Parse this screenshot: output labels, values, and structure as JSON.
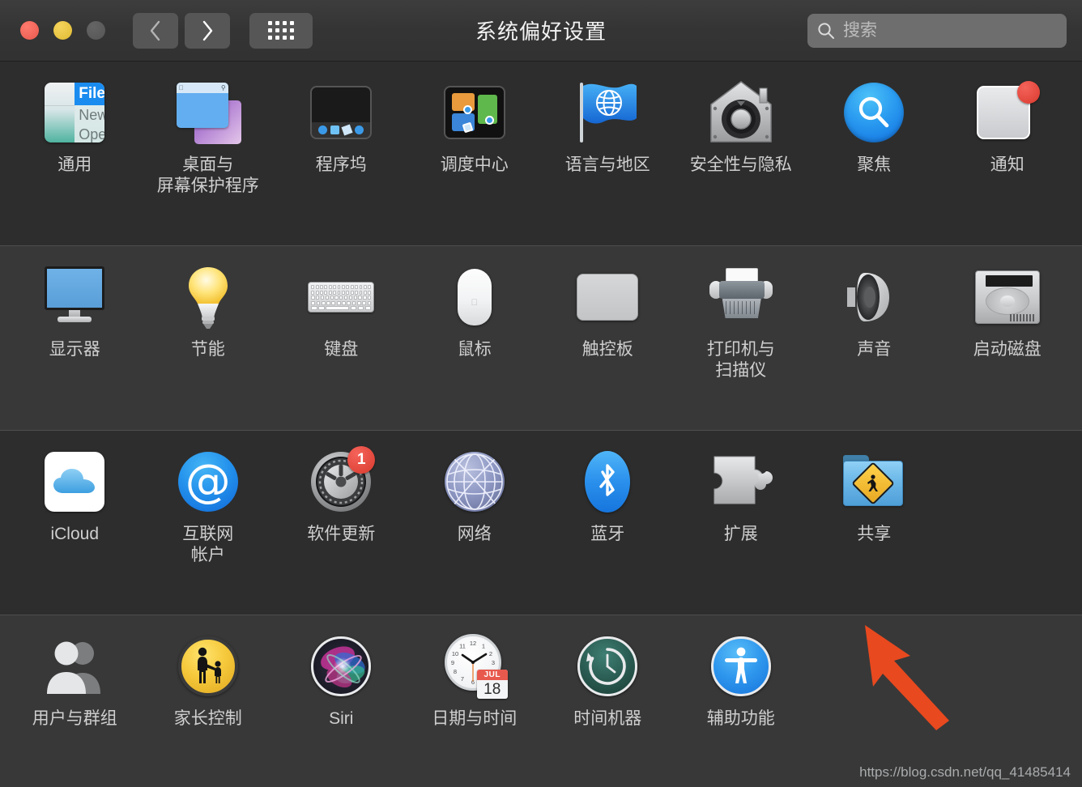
{
  "window": {
    "title": "系统偏好设置",
    "traffic_lights": [
      "close",
      "minimize",
      "zoom"
    ],
    "nav": {
      "back": "‹",
      "forward": "›",
      "grid": "grid-view"
    }
  },
  "search": {
    "placeholder": "搜索",
    "value": "",
    "icon": "search-icon"
  },
  "rows": [
    {
      "items": [
        {
          "label": "通用",
          "icon": "general-icon",
          "menu_file": "File",
          "menu_new": "New",
          "menu_open": "Ope"
        },
        {
          "label": "桌面与\n屏幕保护程序",
          "icon": "desktop-screensaver-icon"
        },
        {
          "label": "程序坞",
          "icon": "dock-icon"
        },
        {
          "label": "调度中心",
          "icon": "mission-control-icon"
        },
        {
          "label": "语言与地区",
          "icon": "language-region-icon"
        },
        {
          "label": "安全性与隐私",
          "icon": "security-privacy-icon"
        },
        {
          "label": "聚焦",
          "icon": "spotlight-icon"
        },
        {
          "label": "通知",
          "icon": "notifications-icon"
        }
      ]
    },
    {
      "items": [
        {
          "label": "显示器",
          "icon": "displays-icon"
        },
        {
          "label": "节能",
          "icon": "energy-saver-icon"
        },
        {
          "label": "键盘",
          "icon": "keyboard-icon"
        },
        {
          "label": "鼠标",
          "icon": "mouse-icon"
        },
        {
          "label": "触控板",
          "icon": "trackpad-icon"
        },
        {
          "label": "打印机与\n扫描仪",
          "icon": "printers-scanners-icon"
        },
        {
          "label": "声音",
          "icon": "sound-icon"
        },
        {
          "label": "启动磁盘",
          "icon": "startup-disk-icon"
        }
      ]
    },
    {
      "items": [
        {
          "label": "iCloud",
          "icon": "icloud-icon"
        },
        {
          "label": "互联网\n帐户",
          "icon": "internet-accounts-icon"
        },
        {
          "label": "软件更新",
          "icon": "software-update-icon",
          "badge": "1"
        },
        {
          "label": "网络",
          "icon": "network-icon"
        },
        {
          "label": "蓝牙",
          "icon": "bluetooth-icon"
        },
        {
          "label": "扩展",
          "icon": "extensions-icon"
        },
        {
          "label": "共享",
          "icon": "sharing-icon"
        },
        {
          "label": "",
          "icon": ""
        }
      ]
    },
    {
      "items": [
        {
          "label": "用户与群组",
          "icon": "users-groups-icon"
        },
        {
          "label": "家长控制",
          "icon": "parental-controls-icon"
        },
        {
          "label": "Siri",
          "icon": "siri-icon"
        },
        {
          "label": "日期与时间",
          "icon": "date-time-icon",
          "cal_month": "JUL",
          "cal_day": "18"
        },
        {
          "label": "时间机器",
          "icon": "time-machine-icon"
        },
        {
          "label": "辅助功能",
          "icon": "accessibility-icon"
        },
        {
          "label": "",
          "icon": ""
        },
        {
          "label": "",
          "icon": ""
        }
      ]
    }
  ],
  "annotation": {
    "arrow_color": "#e8491f",
    "points_to": "共享"
  },
  "watermark": "https://blog.csdn.net/qq_41485414",
  "colors": {
    "window_bg": "#2b2b2b",
    "row_dark": "#2d2d2d",
    "row_light": "#383838",
    "titlebar": "#343434",
    "label": "#cfcfcf",
    "badge_red": "#d93a2e",
    "accent_blue": "#2a90ec"
  }
}
